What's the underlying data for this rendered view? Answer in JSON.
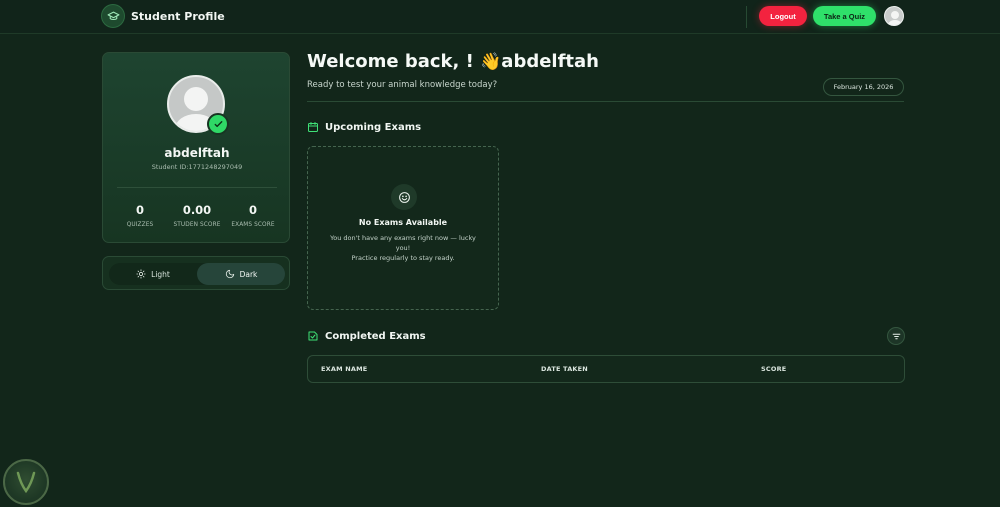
{
  "header": {
    "title": "Student Profile",
    "logout_label": "Logout",
    "quiz_label": "Take a Quiz"
  },
  "profile": {
    "name": "abdelftah",
    "student_id": "Student ID:1771248297049",
    "stats": [
      {
        "value": "0",
        "label": "QUIZZES"
      },
      {
        "value": "0.00",
        "label": "STUDEN SCORE"
      },
      {
        "value": "0",
        "label": "EXAMS SCORE"
      }
    ]
  },
  "theme": {
    "light_label": "Light",
    "dark_label": "Dark",
    "selected": "Dark"
  },
  "welcome": {
    "greeting": "Welcome back, !",
    "emoji": "👋",
    "username": "abdelftah",
    "subtitle": "Ready to test your animal knowledge today?",
    "date": "February 16, 2026"
  },
  "upcoming": {
    "title": "Upcoming Exams",
    "empty_title": "No Exams Available",
    "empty_line1": "You don't have any exams right now — lucky you!",
    "empty_line2": "Practice regularly to stay ready."
  },
  "completed": {
    "title": "Completed Exams",
    "columns": [
      "EXAM NAME",
      "DATE TAKEN",
      "SCORE"
    ]
  },
  "colors": {
    "accent_green": "#2fe06a",
    "logout_red": "#f3233f",
    "background": "#12261a"
  },
  "icons": {
    "brand": "graduation-cap-icon",
    "verified": "check-icon",
    "light": "sun-icon",
    "dark": "moon-icon",
    "upcoming": "calendar-icon",
    "empty": "smile-icon",
    "completed": "clipboard-check-icon",
    "filter": "filter-icon"
  }
}
